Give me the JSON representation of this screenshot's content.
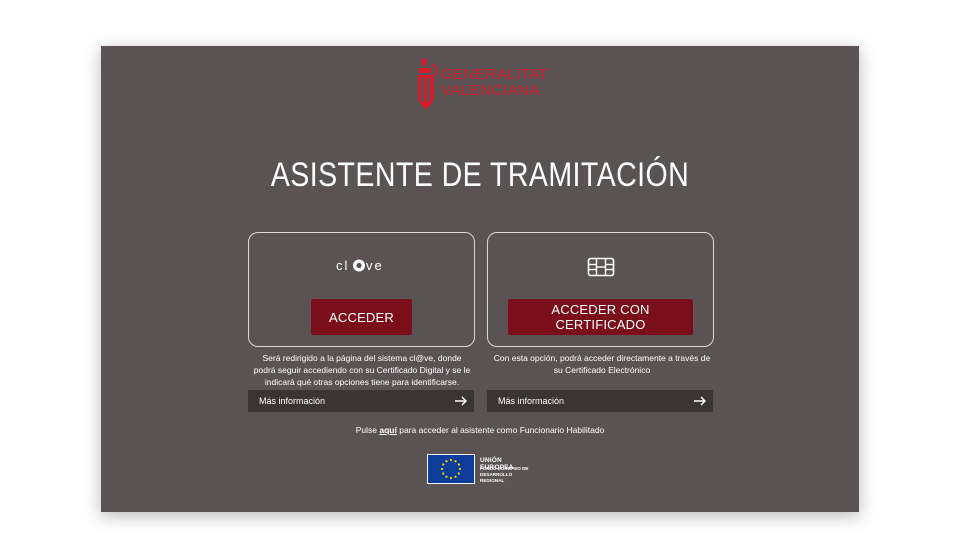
{
  "header": {
    "logo_line1": "GENERALITAT",
    "logo_line2": "VALENCIANA",
    "title": "ASISTENTE DE TRAMITACIÓN"
  },
  "options": [
    {
      "icon": "clave-logo",
      "logo_text": "cl@ve",
      "button_label": "ACCEDER",
      "description": "Será redirigido a la página del sistema cl@ve, donde podrá seguir accediendo con su Certificado Digital y se le indicará qué otras opciones tiene para identificarse.",
      "info_label": "Más información"
    },
    {
      "icon": "certificate-chip-icon",
      "button_label": "ACCEDER CON CERTIFICADO",
      "description": "Con esta opción, podrá acceder directamente a través de su Certificado Electrónico",
      "info_label": "Más información"
    }
  ],
  "footer": {
    "pulse_prefix": "Pulse",
    "pulse_link": "aquí",
    "pulse_suffix": "para acceder al asistente como Funcionario Habilitado",
    "eu_title": "UNIÓN EUROPEA",
    "eu_line1": "FONDO EUROPEO DE",
    "eu_line2": "DESARROLLO REGIONAL"
  },
  "colors": {
    "panel": "#5b5353",
    "button": "#7a0e1b",
    "info_bar": "#3b3434",
    "brand_red": "#d61a2a",
    "eu_blue": "#0d3d98"
  }
}
